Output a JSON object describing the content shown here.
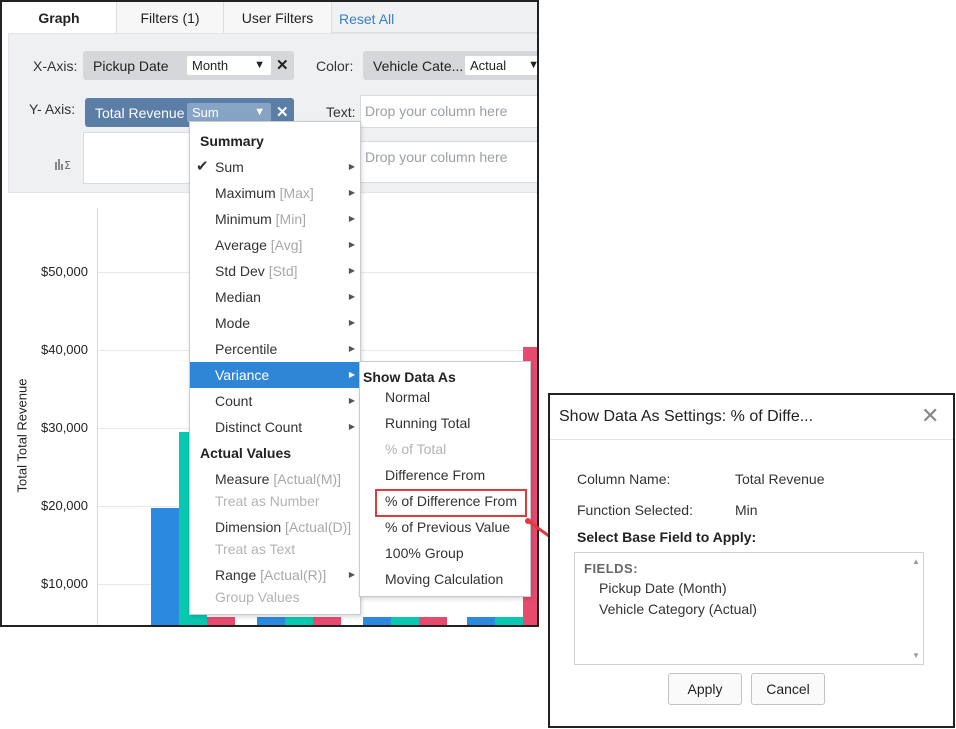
{
  "tabs": [
    {
      "label": "Graph"
    },
    {
      "label": "Filters (1)"
    },
    {
      "label": "User Filters"
    }
  ],
  "reset_label": "Reset All",
  "config": {
    "x_axis_label": "X-Axis:",
    "x_field": "Pickup Date",
    "x_function": "Month",
    "y_axis_label": "Y- Axis:",
    "y_field": "Total Revenue",
    "y_function": "Sum",
    "color_label": "Color:",
    "color_field": "Vehicle Cate...",
    "color_function": "Actual",
    "text_label": "Text:",
    "text_placeholder": "Drop your column here",
    "extra_placeholder": "Drop your column here",
    "close_glyph": "✕",
    "chevron_glyph": "▼"
  },
  "chart_data": {
    "type": "bar",
    "ylabel": "Total Total Revenue",
    "yticks": [
      "$50,000",
      "$40,000",
      "$30,000",
      "$20,000",
      "$10,000"
    ],
    "ylim": [
      0,
      55000
    ],
    "series_colors": [
      "#2b8ae0",
      "#08c9b0",
      "#e84a6e"
    ],
    "visible_bars": [
      {
        "group": 0,
        "series": 0,
        "value": 15500
      },
      {
        "group": 0,
        "series": 1,
        "value": 25200
      },
      {
        "group": 0,
        "series": 2,
        "value": 1500
      },
      {
        "group": 1,
        "series": 0,
        "value": 1500
      },
      {
        "group": 1,
        "series": 1,
        "value": 1500
      },
      {
        "group": 1,
        "series": 2,
        "value": 1500
      },
      {
        "group": 2,
        "series": 0,
        "value": 1500
      },
      {
        "group": 2,
        "series": 1,
        "value": 1500
      },
      {
        "group": 2,
        "series": 2,
        "value": 1500
      },
      {
        "group": 3,
        "series": 0,
        "value": 1500
      },
      {
        "group": 3,
        "series": 1,
        "value": 1500
      },
      {
        "group": 3,
        "series": 2,
        "value": 36200
      }
    ]
  },
  "menu": {
    "items": [
      {
        "label": "Summary",
        "suffix": "",
        "type": "head"
      },
      {
        "label": "Sum",
        "suffix": "",
        "type": "check",
        "arrow": true
      },
      {
        "label": "Maximum",
        "suffix": "[Max]",
        "arrow": true
      },
      {
        "label": "Minimum",
        "suffix": "[Min]",
        "arrow": true
      },
      {
        "label": "Average",
        "suffix": "[Avg]",
        "arrow": true
      },
      {
        "label": "Std Dev",
        "suffix": "[Std]",
        "arrow": true
      },
      {
        "label": "Median",
        "suffix": "",
        "arrow": true
      },
      {
        "label": "Mode",
        "suffix": "",
        "arrow": true
      },
      {
        "label": "Percentile",
        "suffix": "",
        "arrow": true
      },
      {
        "label": "Variance",
        "suffix": "",
        "type": "sel",
        "arrow": true
      },
      {
        "label": "Count",
        "suffix": "",
        "arrow": true
      },
      {
        "label": "Distinct Count",
        "suffix": "",
        "arrow": true
      },
      {
        "label": "Actual Values",
        "suffix": "",
        "type": "head"
      },
      {
        "label": "Measure",
        "suffix": "[Actual(M)]"
      },
      {
        "label": "Treat as Number",
        "suffix": "",
        "type": "dis"
      },
      {
        "label": "Dimension",
        "suffix": "[Actual(D)]"
      },
      {
        "label": "Treat as Text",
        "suffix": "",
        "type": "dis"
      },
      {
        "label": "Range",
        "suffix": "[Actual(R)]",
        "arrow": true
      },
      {
        "label": "Group Values",
        "suffix": "",
        "type": "dis"
      }
    ],
    "check_glyph": "✔",
    "arrow_glyph": "▶"
  },
  "submenu": {
    "items": [
      {
        "label": "Show Data As",
        "type": "head"
      },
      {
        "label": "Normal"
      },
      {
        "label": "Running Total"
      },
      {
        "label": "% of Total",
        "type": "dis"
      },
      {
        "label": "Difference From"
      },
      {
        "label": "% of Difference From",
        "type": "boxed"
      },
      {
        "label": "% of Previous Value"
      },
      {
        "label": "100% Group"
      },
      {
        "label": "Moving Calculation"
      }
    ]
  },
  "dialog": {
    "title": "Show Data As Settings: % of Diffe...",
    "close_glyph": "✕",
    "column_name_label": "Column Name:",
    "column_name_value": "Total Revenue",
    "function_label": "Function Selected:",
    "function_value": "Min",
    "base_field_label": "Select Base Field to Apply:",
    "fields_heading": "FIELDS:",
    "fields": [
      "Pickup Date (Month)",
      "Vehicle Category (Actual)"
    ],
    "apply_label": "Apply",
    "cancel_label": "Cancel",
    "scroll_up_glyph": "▲",
    "scroll_down_glyph": "▼"
  },
  "colors": {
    "accent": "#2f86d6",
    "highlight": "#e0393e",
    "chip_blue": "#5b7ea7"
  }
}
